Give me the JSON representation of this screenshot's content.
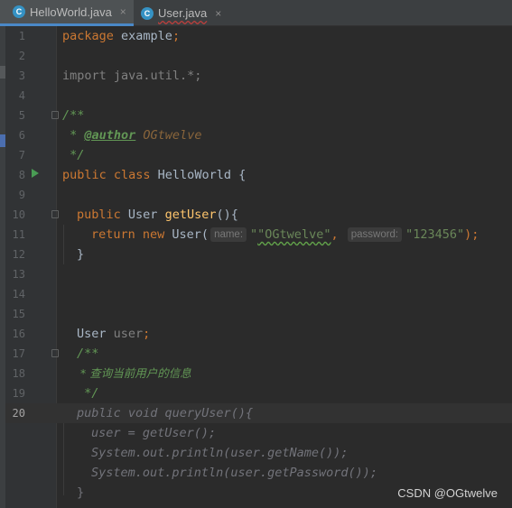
{
  "tabs": [
    {
      "label": "HelloWorld.java",
      "icon": "java-class-icon",
      "icon_letter": "C",
      "close": "×",
      "active": true
    },
    {
      "label": "User.java",
      "icon": "java-class-icon",
      "icon_letter": "C",
      "close": "×",
      "active": false
    }
  ],
  "line_numbers": [
    "1",
    "2",
    "3",
    "4",
    "5",
    "6",
    "7",
    "8",
    "9",
    "10",
    "11",
    "12",
    "13",
    "14",
    "15",
    "16",
    "17",
    "18",
    "19",
    "20"
  ],
  "current_line": "20",
  "code": {
    "l1_kw": "package",
    "l1_name": " example",
    "l1_semi": ";",
    "l3": "import java.util.*;",
    "l5": "/**",
    "l6_star": " * ",
    "l6_tag": "@author",
    "l6_val": " OGtwelve",
    "l7": " */",
    "l8_kw": "public class",
    "l8_rest": " HelloWorld {",
    "l10_kw": "public",
    "l10_type": " User ",
    "l10_method": "getUser",
    "l10_rest": "(){",
    "l11_kw": "return new",
    "l11_call": " User(",
    "l11_hint1": "name:",
    "l11_str1": "\"OGtwelve\"",
    "l11_comma": ", ",
    "l11_hint2": "password:",
    "l11_str2": "\"123456\"",
    "l11_end": ");",
    "l12": "}",
    "l16_type": "User ",
    "l16_field": "user",
    "l16_semi": ";",
    "l17": "/**",
    "l18": " * 查询当前用户的信息",
    "l19": " */",
    "l20_kw": "public void",
    "l20_method": " queryUser",
    "l20_rest": "(){",
    "l21_field": "user",
    "l21_rest": " = getUser();",
    "l22": "System.out.println(user.getName());",
    "l23": "System.out.println(user.getPassword());",
    "l24": "}"
  },
  "watermark": "CSDN @OGtwelve"
}
